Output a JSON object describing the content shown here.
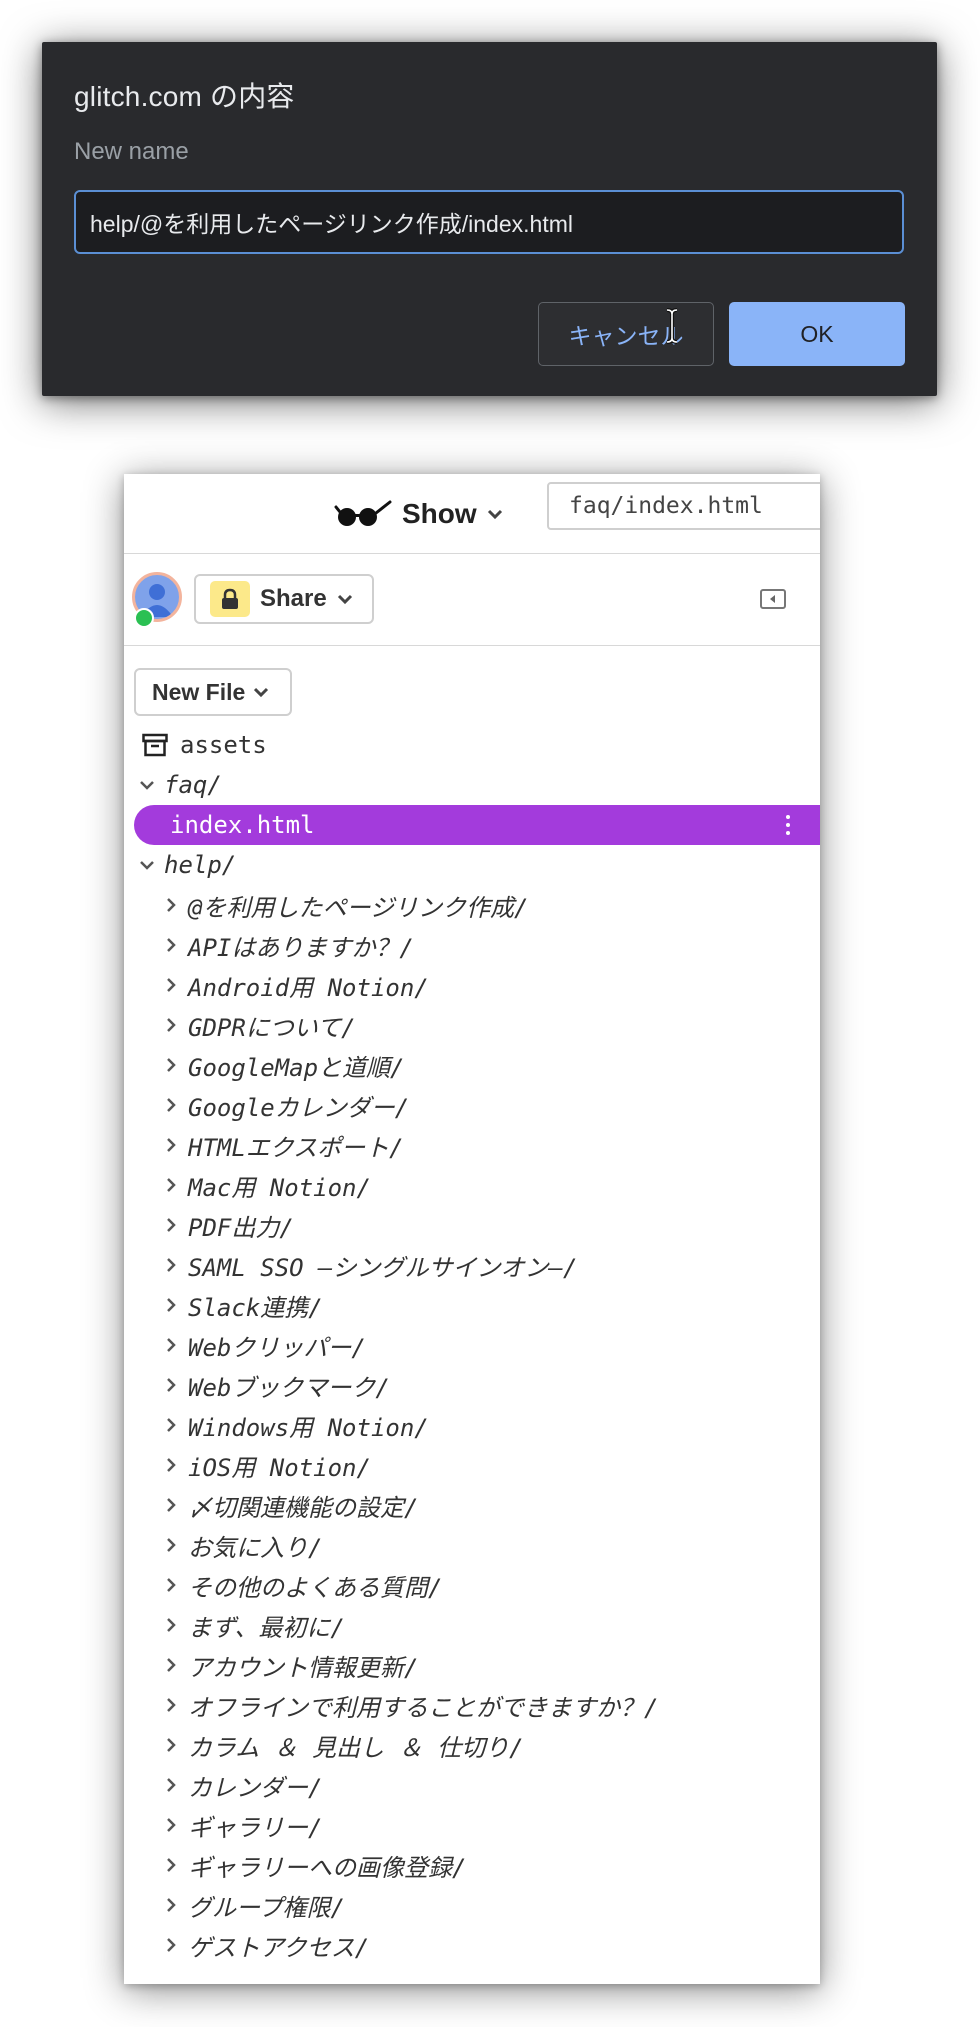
{
  "dialog": {
    "title": "glitch.com の内容",
    "label": "New name",
    "input_value": "help/@を利用したページリンク作成/index.html",
    "cancel_label": "キャンセル",
    "ok_label": "OK"
  },
  "panel": {
    "show_label": "Show",
    "url_value": "faq/index.html",
    "share_label": "Share",
    "new_file_label": "New File",
    "assets_label": "assets",
    "faq_label": "faq/",
    "selected_file": "index.html",
    "help_label": "help/",
    "help_items": [
      "@を利用したページリンク作成/",
      "APIはありますか？/",
      "Android用 Notion/",
      "GDPRについて/",
      "GoogleMapと道順/",
      "Googleカレンダー/",
      "HTMLエクスポート/",
      "Mac用 Notion/",
      "PDF出力/",
      "SAML SSO –シングルサインオン–/",
      "Slack連携/",
      "Webクリッパー/",
      "Webブックマーク/",
      "Windows用 Notion/",
      "iOS用 Notion/",
      "〆切関連機能の設定/",
      "お気に入り/",
      "その他のよくある質問/",
      "まず、最初に/",
      "アカウント情報更新/",
      "オフラインで利用することができますか？/",
      "カラム ＆ 見出し ＆ 仕切り/",
      "カレンダー/",
      "ギャラリー/",
      "ギャラリーへの画像登録/",
      "グループ権限/",
      "ゲストアクセス/"
    ]
  },
  "colors": {
    "dialog_bg": "#292a2d",
    "accent_blue": "#8ab4f8",
    "selected_bg": "#a33bdc",
    "online_green": "#2bc053",
    "lock_yellow": "#fce98a"
  }
}
